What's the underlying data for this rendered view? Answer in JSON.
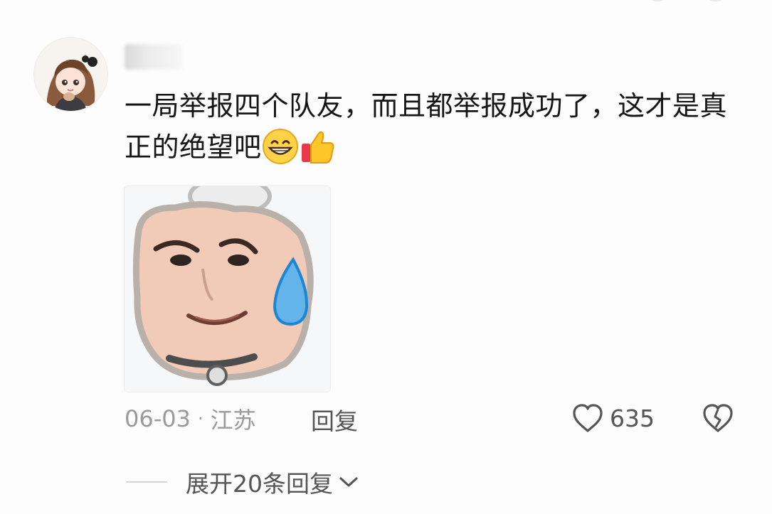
{
  "comment": {
    "username": "",
    "text": "一局举报四个队友，而且都举报成功了，这才是真正的绝望吧",
    "emojis": [
      "grinning-face-emoji",
      "thumbs-up-emoji"
    ],
    "date": "06-03",
    "separator": "·",
    "location": "江苏",
    "reply_label": "回复",
    "like_count": "635",
    "expand_replies_label": "展开20条回复"
  },
  "icons": {
    "like": "heart-outline-icon",
    "dislike": "broken-heart-icon",
    "expand": "chevron-down-icon"
  },
  "colors": {
    "text_primary": "#151515",
    "text_secondary": "#9a9a9a",
    "action_text": "#555555"
  }
}
